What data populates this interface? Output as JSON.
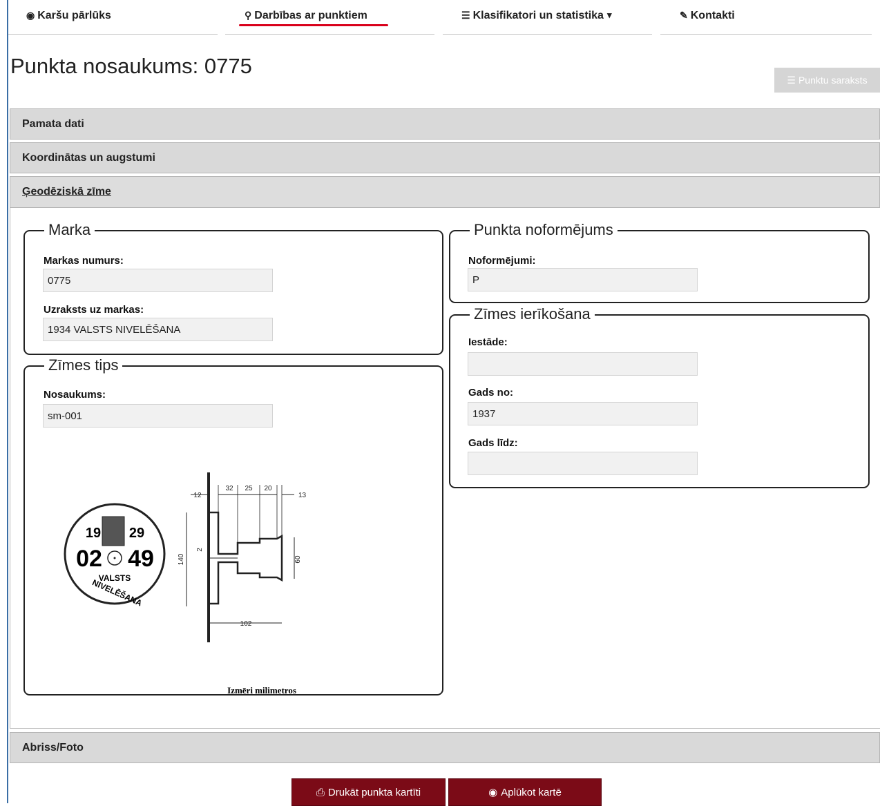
{
  "nav": {
    "items": [
      {
        "icon": "globe-icon",
        "glyph": "🌍",
        "label": "Karšu pārlūks"
      },
      {
        "icon": "map-marker-icon",
        "glyph": "⚲",
        "label": "Darbības ar punktiem"
      },
      {
        "icon": "list-icon",
        "glyph": "☰",
        "label": "Klasifikatori un statistika"
      },
      {
        "icon": "edit-icon",
        "glyph": "✎",
        "label": "Kontakti"
      }
    ],
    "dropdown_caret": "▾"
  },
  "page": {
    "title": "Punkta nosaukums: 0775"
  },
  "list_button": {
    "label": "Punktu saraksts"
  },
  "accordion": {
    "sections": [
      "Pamata dati",
      "Koordinātas un augstumi",
      "Ģeodēziskā zīme",
      "Abriss/Foto"
    ]
  },
  "marka": {
    "legend": "Marka",
    "number_label": "Markas numurs:",
    "number_value": "0775",
    "inscription_label": "Uzraksts uz markas:",
    "inscription_value": "1934 VALSTS NIVELĒŠANA"
  },
  "zimes_tips": {
    "legend": "Zīmes tips",
    "name_label": "Nosaukums:",
    "name_value": "sm-001"
  },
  "drawing": {
    "plaque_top_left": "19",
    "plaque_top_right": "29",
    "plaque_mid_left": "02",
    "plaque_mid_right": "49",
    "plaque_text1": "VALSTS",
    "plaque_text2": "NIVELĒŠANA",
    "dims": [
      "12",
      "32",
      "25",
      "20",
      "13",
      "140",
      "2",
      "60",
      "102"
    ],
    "caption": "Izmēri milimetros"
  },
  "noformejums": {
    "legend": "Punkta noformējums",
    "label": "Noformējumi:",
    "value": "P"
  },
  "ierikosana": {
    "legend": "Zīmes ierīkošana",
    "institution_label": "Iestāde:",
    "institution_value": "",
    "from_label": "Gads no:",
    "from_value": "1937",
    "to_label": "Gads līdz:",
    "to_value": ""
  },
  "actions": {
    "print_label": "Drukāt punkta kartīti",
    "map_label": "Aplūkot kartē"
  },
  "colors": {
    "accent_red": "#d9001b",
    "button_dark_red": "#7b0b17",
    "accordion_bg": "#d9d9d9"
  }
}
